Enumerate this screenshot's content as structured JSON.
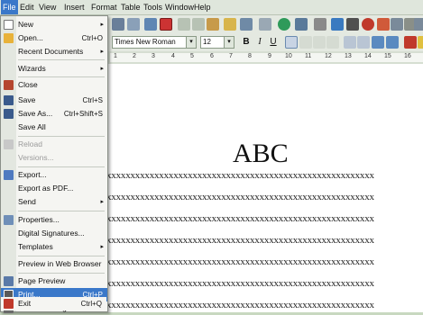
{
  "menubar": {
    "items": [
      "File",
      "Edit",
      "View",
      "Insert",
      "Format",
      "Table",
      "Tools",
      "Window",
      "Help"
    ]
  },
  "toolbar": {
    "font_name": "Times New Roman",
    "font_size": "12",
    "bold": "B",
    "italic": "I",
    "underline": "U"
  },
  "ruler": {
    "ticks": [
      "1",
      "2",
      "3",
      "4",
      "5",
      "6",
      "7",
      "8",
      "9",
      "10",
      "11",
      "12",
      "13",
      "14",
      "15",
      "16"
    ]
  },
  "document": {
    "title": "ABC",
    "line_text": "xxxxxxxxxxxxxxxxxxxxxxxxxxxxxxxxxxxxxxxxxxxxxxxxxxxxxxxx"
  },
  "file_menu": {
    "items": [
      {
        "label": "New",
        "submenu": true,
        "icon": "new-document-icon",
        "color": "#ffffff"
      },
      {
        "label": "Open...",
        "shortcut": "Ctrl+O",
        "icon": "open-folder-icon",
        "color": "#e8b23a"
      },
      {
        "label": "Recent Documents",
        "submenu": true
      },
      {
        "label": "Wizards",
        "submenu": true
      },
      {
        "label": "Close",
        "icon": "close-document-icon",
        "color": "#b5462f"
      },
      {
        "label": "Save",
        "shortcut": "Ctrl+S",
        "icon": "save-icon",
        "color": "#3a5a8c"
      },
      {
        "label": "Save As...",
        "shortcut": "Ctrl+Shift+S",
        "icon": "save-as-icon",
        "color": "#3a5a8c"
      },
      {
        "label": "Save All"
      },
      {
        "label": "Reload",
        "disabled": true,
        "icon": "reload-icon",
        "color": "#b0b0b0"
      },
      {
        "label": "Versions...",
        "disabled": true
      },
      {
        "label": "Export...",
        "icon": "export-icon",
        "color": "#4f7ac0"
      },
      {
        "label": "Export as PDF..."
      },
      {
        "label": "Send",
        "submenu": true
      },
      {
        "label": "Properties...",
        "icon": "properties-icon",
        "color": "#6f8fb8"
      },
      {
        "label": "Digital Signatures..."
      },
      {
        "label": "Templates",
        "submenu": true
      },
      {
        "label": "Preview in Web Browser"
      },
      {
        "label": "Page Preview",
        "icon": "page-preview-icon",
        "color": "#5a7aa8"
      },
      {
        "label": "Print...",
        "shortcut": "Ctrl+P",
        "icon": "print-icon",
        "color": "#5a5a5a",
        "highlighted": true
      },
      {
        "label": "Printer Settings...",
        "icon": "printer-settings-icon",
        "color": "#6a6a6a"
      },
      {
        "label": "Exit",
        "shortcut": "Ctrl+Q",
        "icon": "exit-icon",
        "color": "#c0392b"
      }
    ]
  },
  "colors": {
    "highlight": "#3a78c9",
    "menu_bg": "#f5f5f2",
    "toolbar_bg": "#e4e9e1"
  }
}
